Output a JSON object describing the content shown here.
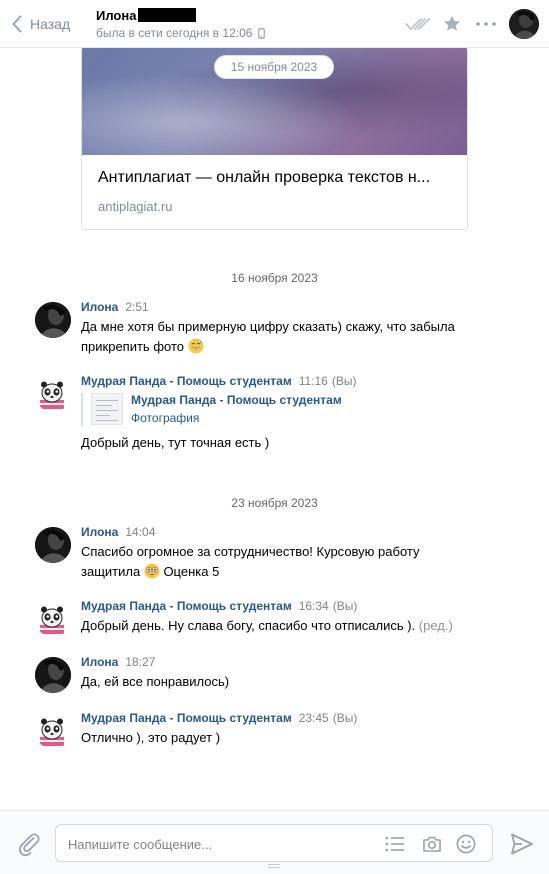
{
  "header": {
    "back_label": "Назад",
    "peer_name": "Илона",
    "peer_status": "была в сети сегодня в 12:06",
    "icons": [
      "chevron-left-icon",
      "double-check-icon",
      "star-icon",
      "more-icon",
      "phone-icon"
    ]
  },
  "link_card": {
    "date_pill": "15 ноября 2023",
    "title": "Антиплагиат — онлайн проверка текстов н...",
    "domain": "antiplagiat.ru"
  },
  "day_separators": [
    "16 ноября 2023",
    "23 ноября 2023"
  ],
  "messages": [
    {
      "author": "Илона",
      "time": "2:51",
      "text": "Да мне хотя бы примерную цифру сказать) скажу, что забыла",
      "text2": "прикрепить фото"
    },
    {
      "author": "Мудрая Панда - Помощь студентам",
      "time": "11:16",
      "vy": "(Вы)",
      "forward": {
        "title": "Мудрая Панда - Помощь студентам",
        "subtitle": "Фотография"
      },
      "text": "Добрый день, тут точная есть )"
    },
    {
      "author": "Илона",
      "time": "14:04",
      "text": "Спасибо огромное за сотрудничество! Курсовую работу",
      "text2a": "защитила",
      "text2b": "Оценка 5"
    },
    {
      "author": "Мудрая Панда - Помощь студентам",
      "time": "16:34",
      "vy": "(Вы)",
      "text": "Добрый день. Ну слава богу, спасибо что отписались ).",
      "edited": "(ред.)"
    },
    {
      "author": "Илона",
      "time": "18:27",
      "text": "Да, ей все понравилось)"
    },
    {
      "author": "Мудрая Панда - Помощь студентам",
      "time": "23:45",
      "vy": "(Вы)",
      "text": "Отлично ), это радует )"
    }
  ],
  "composer": {
    "placeholder": "Напишите сообщение...",
    "icons": [
      "paperclip-icon",
      "template-list-icon",
      "camera-icon",
      "smile-icon",
      "send-icon"
    ]
  },
  "colors": {
    "link": "#2a5885",
    "muted": "#818c99",
    "border": "#dce1e6"
  }
}
